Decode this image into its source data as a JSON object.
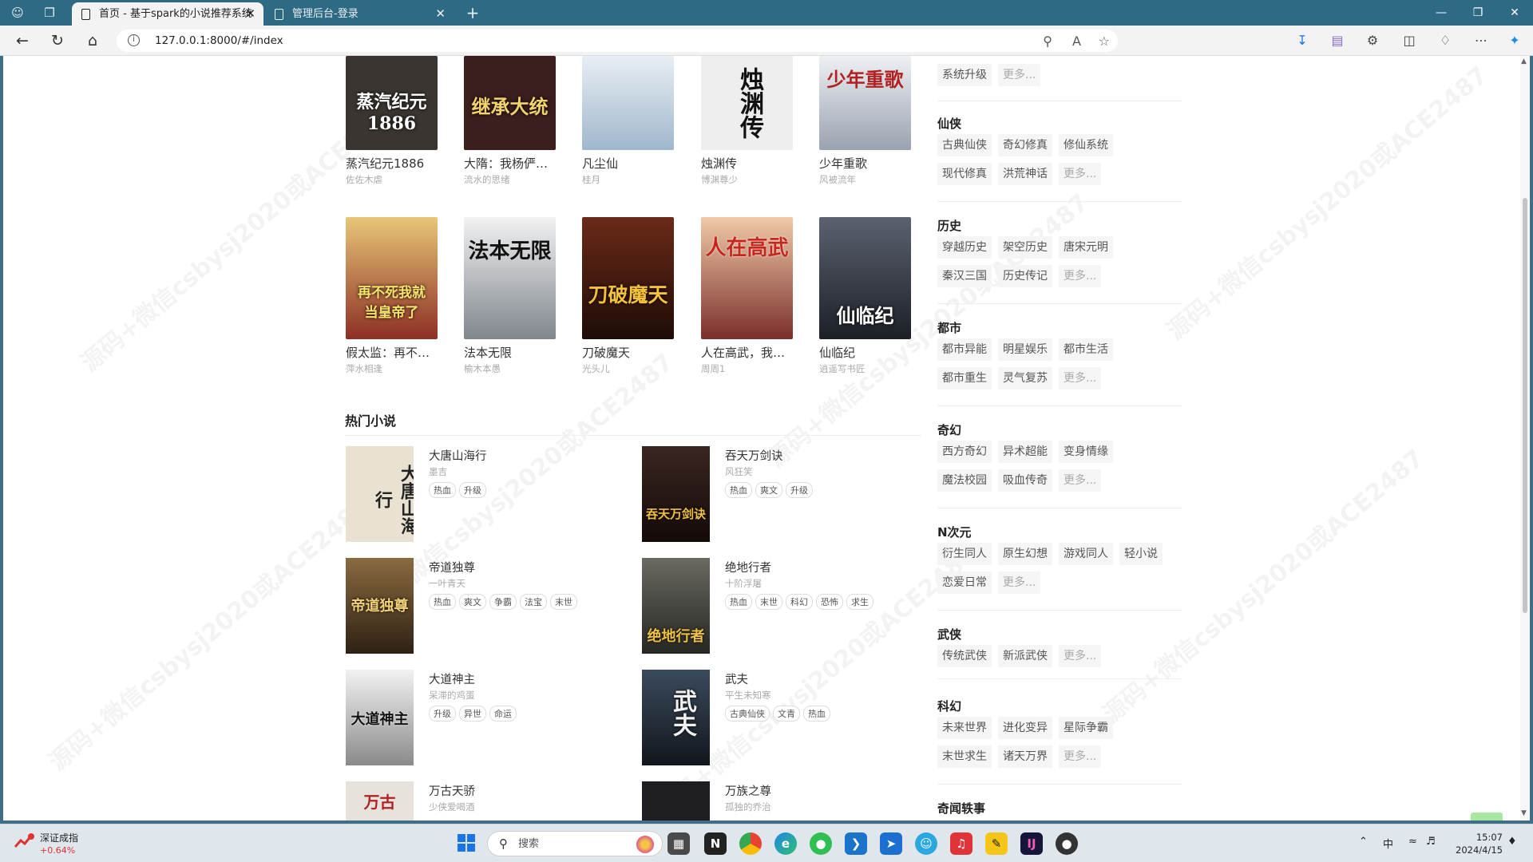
{
  "browser": {
    "tabs": [
      {
        "title": "首页 - 基于spark的小说推荐系统",
        "active": true
      },
      {
        "title": "管理后台-登录",
        "active": false
      }
    ],
    "url": "127.0.0.1:8000/#/index"
  },
  "grid": {
    "rows": [
      [
        {
          "title": "蒸汽纪元1886",
          "author": "佐佐木虐",
          "cover_text": "蒸汽纪元1886",
          "cover_color": "#3a3530"
        },
        {
          "title": "大隋：我杨俨，...",
          "author": "流水的思绪",
          "cover_text": "继承大统",
          "cover_color": "#3b1e1e"
        },
        {
          "title": "凡尘仙",
          "author": "桂月",
          "cover_text": "",
          "cover_color": "#c9d8e6"
        },
        {
          "title": "烛渊传",
          "author": "博渊尊少",
          "cover_text": "烛渊传",
          "cover_color": "#eeeeee"
        },
        {
          "title": "少年重歌",
          "author": "风被流年",
          "cover_text": "少年重歌",
          "cover_color": "#d7dbe3"
        }
      ],
      [
        {
          "title": "假太监：再不死...",
          "author": "萍水相逢",
          "cover_text": "再不死我就当皇帝了",
          "cover_color": "#8d2f23"
        },
        {
          "title": "法本无限",
          "author": "榆木本愚",
          "cover_text": "法本无限",
          "cover_color": "#b9bec3"
        },
        {
          "title": "刀破魔天",
          "author": "光头儿",
          "cover_text": "刀破魔天",
          "cover_color": "#3c1a12"
        },
        {
          "title": "人在高武，我的...",
          "author": "周周1",
          "cover_text": "人在高武",
          "cover_color": "#b54a3e"
        },
        {
          "title": "仙临纪",
          "author": "逍遥写书匠",
          "cover_text": "仙临纪",
          "cover_color": "#2b2f38"
        }
      ]
    ]
  },
  "hot_section": {
    "title": "热门小说",
    "items": [
      {
        "title": "大唐山海行",
        "author": "墨吉",
        "tags": [
          "热血",
          "升级"
        ],
        "cover_text": "大唐山海行",
        "cover_color": "#e9e2d2"
      },
      {
        "title": "吞天万剑诀",
        "author": "风狂笑",
        "tags": [
          "热血",
          "爽文",
          "升级"
        ],
        "cover_text": "吞天万剑诀",
        "cover_color": "#2a1510"
      },
      {
        "title": "帝道独尊",
        "author": "一叶青天",
        "tags": [
          "热血",
          "爽文",
          "争霸",
          "法宝",
          "末世"
        ],
        "cover_text": "帝道独尊",
        "cover_color": "#4a3420"
      },
      {
        "title": "绝地行者",
        "author": "十阶浮屠",
        "tags": [
          "热血",
          "末世",
          "科幻",
          "恐怖",
          "求生"
        ],
        "cover_text": "绝地行者",
        "cover_color": "#3b3b36"
      },
      {
        "title": "大道神主",
        "author": "呆滞的鸡蛋",
        "tags": [
          "升级",
          "异世",
          "命运"
        ],
        "cover_text": "大道神主",
        "cover_color": "#cfcfcf"
      },
      {
        "title": "武夫",
        "author": "平生未知寒",
        "tags": [
          "古典仙侠",
          "文青",
          "热血"
        ],
        "cover_text": "武夫",
        "cover_color": "#27313d"
      },
      {
        "title": "万古天骄",
        "author": "少侠爱喝酒",
        "tags": [],
        "cover_text": "万古",
        "cover_color": "#e7e2dc"
      },
      {
        "title": "万族之尊",
        "author": "孤独的乔治",
        "tags": [],
        "cover_text": "",
        "cover_color": "#1d1d22"
      }
    ]
  },
  "sidebar": {
    "top_tags": [
      "系统升级",
      "更多..."
    ],
    "categories": [
      {
        "name": "仙侠",
        "tags": [
          "古典仙侠",
          "奇幻修真",
          "修仙系统",
          "现代修真",
          "洪荒神话"
        ],
        "more": "更多..."
      },
      {
        "name": "历史",
        "tags": [
          "穿越历史",
          "架空历史",
          "唐宋元明",
          "秦汉三国",
          "历史传记"
        ],
        "more": "更多..."
      },
      {
        "name": "都市",
        "tags": [
          "都市异能",
          "明星娱乐",
          "都市生活",
          "都市重生",
          "灵气复苏"
        ],
        "more": "更多..."
      },
      {
        "name": "奇幻",
        "tags": [
          "西方奇幻",
          "异术超能",
          "变身情缘",
          "魔法校园",
          "吸血传奇"
        ],
        "more": "更多..."
      },
      {
        "name": "N次元",
        "tags": [
          "衍生同人",
          "原生幻想",
          "游戏同人",
          "轻小说",
          "恋爱日常"
        ],
        "more": "更多..."
      },
      {
        "name": "武侠",
        "tags": [
          "传统武侠",
          "新派武侠"
        ],
        "more": "更多..."
      },
      {
        "name": "科幻",
        "tags": [
          "未来世界",
          "进化变异",
          "星际争霸",
          "末世求生",
          "诸天万界"
        ],
        "more": "更多..."
      },
      {
        "name": "奇闻轶事",
        "tags": [],
        "more": ""
      }
    ]
  },
  "taskbar": {
    "stock_name": "深证成指",
    "stock_change": "+0.64%",
    "search_placeholder": "搜索",
    "ime": "中",
    "time": "15:07",
    "date": "2024/4/15"
  },
  "colors": {
    "accent": "#2f6a84",
    "backtop": "#a8e6a1"
  }
}
